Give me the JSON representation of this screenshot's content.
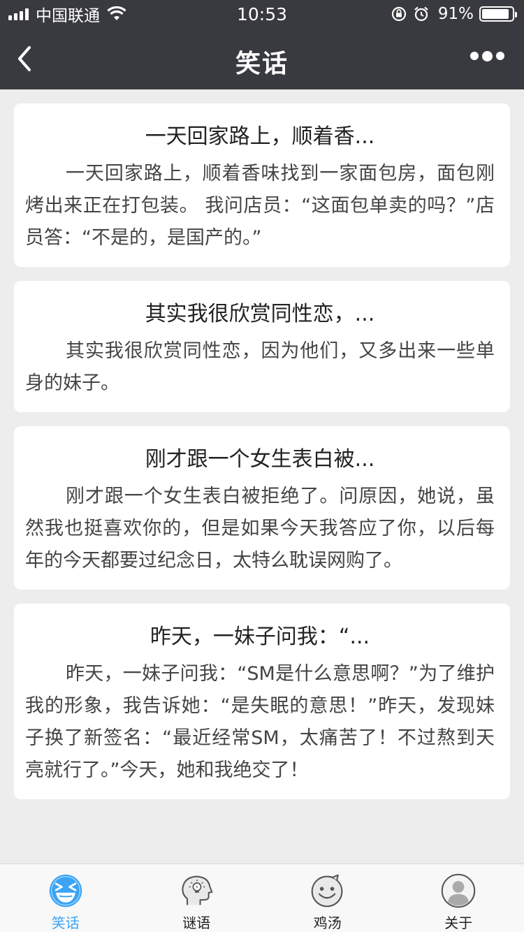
{
  "status_bar": {
    "carrier": "中国联通",
    "time": "10:53",
    "battery_percent": "91%",
    "battery_level": 0.91
  },
  "nav": {
    "title": "笑话"
  },
  "cards": [
    {
      "title": "一天回家路上，顺着香...",
      "body": "一天回家路上，顺着香味找到一家面包房，面包刚烤出来正在打包装。 我问店员：“这面包单卖的吗？”店员答：“不是的，是国产的。”"
    },
    {
      "title": "其实我很欣赏同性恋，...",
      "body": "其实我很欣赏同性恋，因为他们，又多出来一些单身的妹子。"
    },
    {
      "title": "刚才跟一个女生表白被...",
      "body": "刚才跟一个女生表白被拒绝了。问原因，她说，虽然我也挺喜欢你的，但是如果今天我答应了你，以后每年的今天都要过纪念日，太特么耽误网购了。"
    },
    {
      "title": "昨天，一妹子问我：“...",
      "body": "昨天，一妹子问我：“SM是什么意思啊？”为了维护我的形象，我告诉她：“是失眠的意思！”昨天，发现妹子换了新签名：“最近经常SM，太痛苦了！不过熬到天亮就行了。”今天，她和我绝交了！"
    }
  ],
  "tabs": [
    {
      "label": "笑话",
      "icon": "laughing-face-icon",
      "active": true
    },
    {
      "label": "谜语",
      "icon": "thinking-head-icon",
      "active": false
    },
    {
      "label": "鸡汤",
      "icon": "smiley-face-icon",
      "active": false
    },
    {
      "label": "关于",
      "icon": "user-avatar-icon",
      "active": false
    }
  ],
  "colors": {
    "bar_bg": "#393a3f",
    "accent": "#3ba4f6",
    "page_bg": "#ededed"
  }
}
